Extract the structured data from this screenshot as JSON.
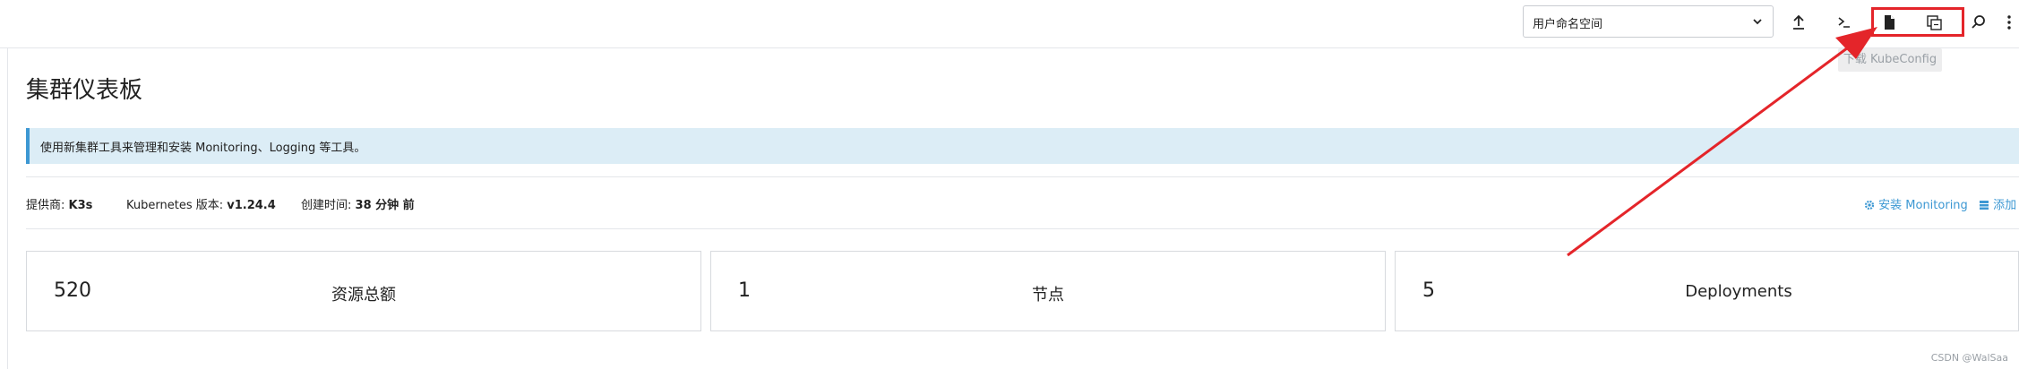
{
  "header": {
    "namespace_select": {
      "value": "用户命名空间"
    },
    "tooltip": "下载 KubeConfig"
  },
  "page": {
    "title": "集群仪表板",
    "banner": "使用新集群工具来管理和安装 Monitoring、Logging 等工具。"
  },
  "meta": {
    "provider_label": "提供商:",
    "provider_value": "K3s",
    "k8s_label": "Kubernetes 版本:",
    "k8s_value": "v1.24.4",
    "created_label": "创建时间:",
    "created_value": "38 分钟 前"
  },
  "actions": {
    "install_monitoring": "安装 Monitoring",
    "add_partial": "添加"
  },
  "cards": [
    {
      "count": "520",
      "label": "资源总额"
    },
    {
      "count": "1",
      "label": "节点"
    },
    {
      "count": "5",
      "label": "Deployments"
    }
  ],
  "footer": {
    "credit": "CSDN @WalSaa"
  },
  "colors": {
    "accent": "#3d98d3",
    "annotation_red": "#e4252a",
    "banner_bg": "#dcedf6"
  },
  "icons": [
    "chevron-down-icon",
    "upload-icon",
    "shell-icon",
    "file-download-icon",
    "copy-kubeconfig-icon",
    "search-icon",
    "more-vertical-icon",
    "gear-icon",
    "list-add-icon"
  ]
}
